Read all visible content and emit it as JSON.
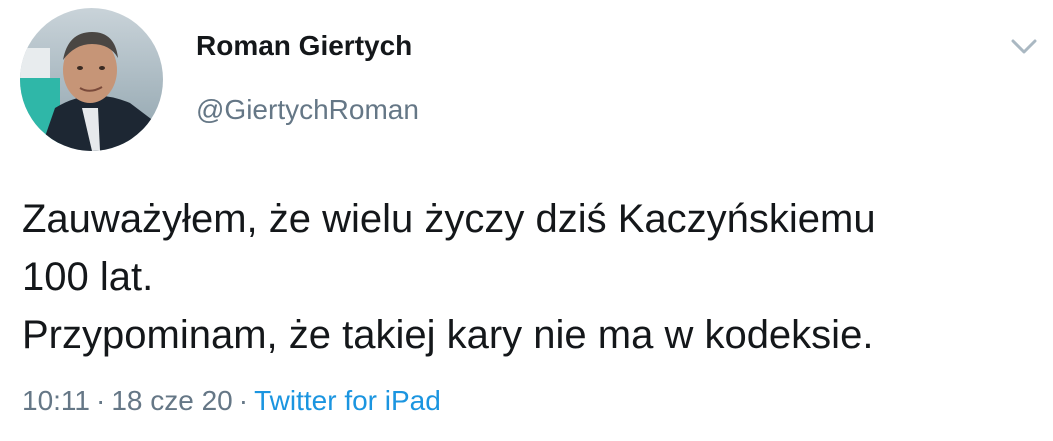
{
  "author": {
    "display_name": "Roman Giertych",
    "handle": "@GiertychRoman",
    "avatar_icon": "profile-photo"
  },
  "menu_icon": "chevron-down-icon",
  "tweet": {
    "lines": [
      "Zauważyłem, że wielu życzy dziś Kaczyńskiemu",
      "100 lat.",
      "Przypominam, że takiej kary nie ma w kodeksie."
    ]
  },
  "meta": {
    "time": "10:11",
    "separator": "·",
    "date": "18 cze 20",
    "source": "Twitter for iPad"
  },
  "colors": {
    "text": "#14171a",
    "secondary": "#657786",
    "link": "#1b95e0"
  }
}
